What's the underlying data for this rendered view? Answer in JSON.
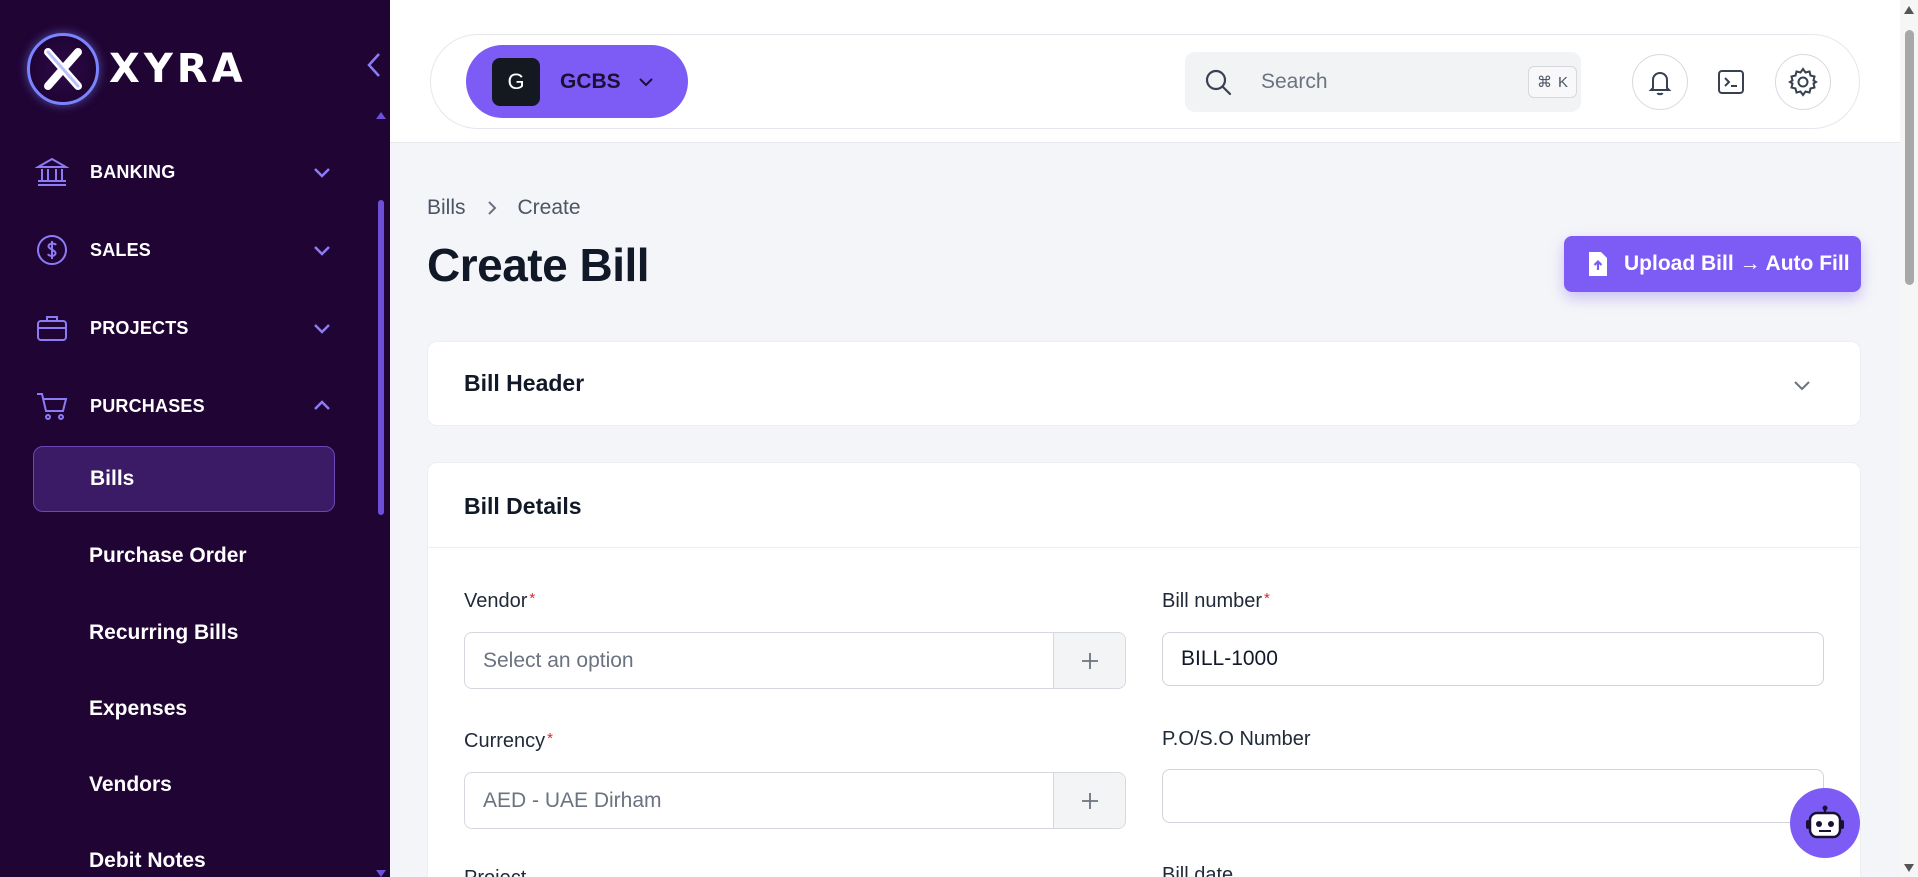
{
  "brand": {
    "name": "XYRA"
  },
  "sidebar": {
    "sections": [
      {
        "label": "BANKING",
        "icon": "bank-icon",
        "expanded": false
      },
      {
        "label": "SALES",
        "icon": "dollar-icon",
        "expanded": false
      },
      {
        "label": "PROJECTS",
        "icon": "briefcase-icon",
        "expanded": false
      },
      {
        "label": "PURCHASES",
        "icon": "cart-icon",
        "expanded": true
      }
    ],
    "purchases_items": [
      {
        "label": "Bills",
        "active": true
      },
      {
        "label": "Purchase Order",
        "active": false
      },
      {
        "label": "Recurring Bills",
        "active": false
      },
      {
        "label": "Expenses",
        "active": false
      },
      {
        "label": "Vendors",
        "active": false
      },
      {
        "label": "Debit Notes",
        "active": false
      }
    ]
  },
  "topbar": {
    "tenant_initial": "G",
    "tenant_name": "GCBS",
    "search_placeholder": "Search",
    "search_shortcut_symbol": "⌘",
    "search_shortcut_key": "K"
  },
  "page": {
    "breadcrumb": [
      "Bills",
      "Create"
    ],
    "title": "Create Bill",
    "upload_button": "Upload Bill → Auto Fill"
  },
  "sections": {
    "header_title": "Bill Header",
    "details_title": "Bill Details"
  },
  "form": {
    "vendor_label": "Vendor",
    "vendor_placeholder": "Select an option",
    "bill_number_label": "Bill number",
    "bill_number_value": "BILL-1000",
    "currency_label": "Currency",
    "currency_value": "AED - UAE Dirham",
    "po_label": "P.O/S.O Number",
    "po_value": "",
    "project_label": "Project",
    "bill_date_label": "Bill date",
    "required_mark": "*"
  },
  "colors": {
    "sidebar_bg": "#200434",
    "accent": "#7d5cf6",
    "active_item_bg": "#3b1a66",
    "required": "#e02424"
  }
}
